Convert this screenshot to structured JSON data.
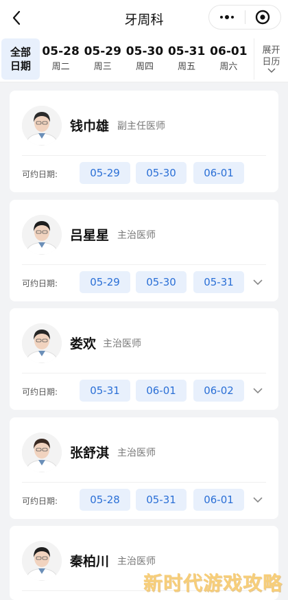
{
  "header": {
    "title": "牙周科"
  },
  "datebar": {
    "all_label_line1": "全部",
    "all_label_line2": "日期",
    "dates": [
      {
        "date": "05-28",
        "weekday": "周二"
      },
      {
        "date": "05-29",
        "weekday": "周三"
      },
      {
        "date": "05-30",
        "weekday": "周四"
      },
      {
        "date": "05-31",
        "weekday": "周五"
      },
      {
        "date": "06-01",
        "weekday": "周六"
      }
    ],
    "expand_line1": "展开",
    "expand_line2": "日历"
  },
  "available_label": "可约日期:",
  "doctors": [
    {
      "name": "钱巾雄",
      "title": "副主任医师",
      "dates": [
        "05-29",
        "05-30",
        "06-01"
      ],
      "has_more": false
    },
    {
      "name": "吕星星",
      "title": "主治医师",
      "dates": [
        "05-29",
        "05-30",
        "05-31"
      ],
      "has_more": true
    },
    {
      "name": "娄欢",
      "title": "主治医师",
      "dates": [
        "05-31",
        "06-01",
        "06-02"
      ],
      "has_more": true
    },
    {
      "name": "张舒淇",
      "title": "主治医师",
      "dates": [
        "05-28",
        "05-31",
        "06-01"
      ],
      "has_more": true
    },
    {
      "name": "秦柏川",
      "title": "主治医师",
      "dates": [
        "",
        "",
        ""
      ],
      "has_more": false
    }
  ],
  "watermark": "新时代游戏攻略",
  "colors": {
    "accent": "#2a6fd6",
    "chip_bg": "#e8f0fc"
  }
}
